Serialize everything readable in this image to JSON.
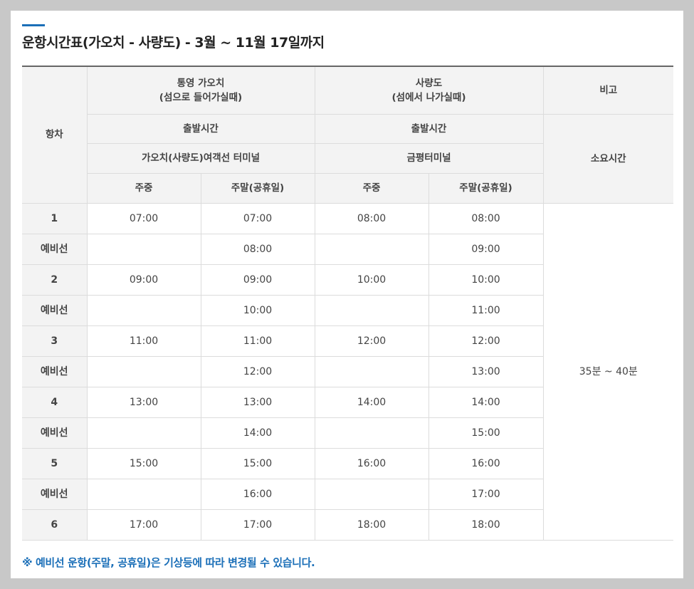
{
  "title": "운항시간표(가오치 - 사량도) - 3월 ~ 11월 17일까지",
  "colors": {
    "accent": "#1b6fb8",
    "header_bg": "#f3f3f3",
    "border": "#dcdcdc"
  },
  "header": {
    "trip_label": "항차",
    "route_a": {
      "line1": "통영 가오치",
      "line2": "(섬으로 들어가실때)"
    },
    "route_b": {
      "line1": "사량도",
      "line2": "(섬에서 나가실때)"
    },
    "remarks": "비고",
    "depart_time_a": "출발시간",
    "depart_time_b": "출발시간",
    "terminal_a": "가오치(사량도)여객선 터미널",
    "terminal_b": "금평터미널",
    "duration_label": "소요시간",
    "weekday_a": "주중",
    "weekend_a": "주말(공휴일)",
    "weekday_b": "주중",
    "weekend_b": "주말(공휴일)"
  },
  "rows": [
    {
      "trip": "1",
      "a_weekday": "07:00",
      "a_weekend": "07:00",
      "b_weekday": "08:00",
      "b_weekend": "08:00"
    },
    {
      "trip": "예비선",
      "a_weekday": "",
      "a_weekend": "08:00",
      "b_weekday": "",
      "b_weekend": "09:00"
    },
    {
      "trip": "2",
      "a_weekday": "09:00",
      "a_weekend": "09:00",
      "b_weekday": "10:00",
      "b_weekend": "10:00"
    },
    {
      "trip": "예비선",
      "a_weekday": "",
      "a_weekend": "10:00",
      "b_weekday": "",
      "b_weekend": "11:00"
    },
    {
      "trip": "3",
      "a_weekday": "11:00",
      "a_weekend": "11:00",
      "b_weekday": "12:00",
      "b_weekend": "12:00"
    },
    {
      "trip": "예비선",
      "a_weekday": "",
      "a_weekend": "12:00",
      "b_weekday": "",
      "b_weekend": "13:00"
    },
    {
      "trip": "4",
      "a_weekday": "13:00",
      "a_weekend": "13:00",
      "b_weekday": "14:00",
      "b_weekend": "14:00"
    },
    {
      "trip": "예비선",
      "a_weekday": "",
      "a_weekend": "14:00",
      "b_weekday": "",
      "b_weekend": "15:00"
    },
    {
      "trip": "5",
      "a_weekday": "15:00",
      "a_weekend": "15:00",
      "b_weekday": "16:00",
      "b_weekend": "16:00"
    },
    {
      "trip": "예비선",
      "a_weekday": "",
      "a_weekend": "16:00",
      "b_weekday": "",
      "b_weekend": "17:00"
    },
    {
      "trip": "6",
      "a_weekday": "17:00",
      "a_weekend": "17:00",
      "b_weekday": "18:00",
      "b_weekend": "18:00"
    }
  ],
  "duration": "35분 ~ 40분",
  "footnote": "※ 예비선 운항(주말, 공휴일)은 기상등에 따라 변경될 수 있습니다."
}
